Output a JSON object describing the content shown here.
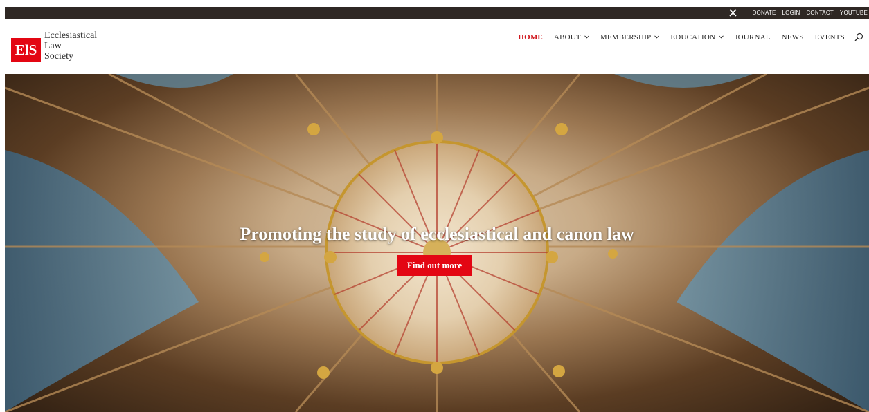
{
  "topbar": {
    "social_icon": "x-icon",
    "links": [
      "DONATE",
      "LOGIN",
      "CONTACT",
      "YOUTUBE"
    ]
  },
  "logo": {
    "mark": "ElS",
    "line1": "Ecclesiastical",
    "line2": "Law",
    "line3": "Society"
  },
  "nav": {
    "items": [
      {
        "label": "HOME",
        "active": true,
        "dropdown": false
      },
      {
        "label": "ABOUT",
        "active": false,
        "dropdown": true
      },
      {
        "label": "MEMBERSHIP",
        "active": false,
        "dropdown": true
      },
      {
        "label": "EDUCATION",
        "active": false,
        "dropdown": true
      },
      {
        "label": "JOURNAL",
        "active": false,
        "dropdown": false
      },
      {
        "label": "NEWS",
        "active": false,
        "dropdown": false
      },
      {
        "label": "EVENTS",
        "active": false,
        "dropdown": false
      }
    ],
    "search_icon": "search-icon"
  },
  "hero": {
    "title": "Promoting the study of ecclesiastical and canon law",
    "button": "Find out more"
  },
  "colors": {
    "accent": "#e30613",
    "topbar": "#2f2824",
    "nav_active": "#d0181f"
  }
}
